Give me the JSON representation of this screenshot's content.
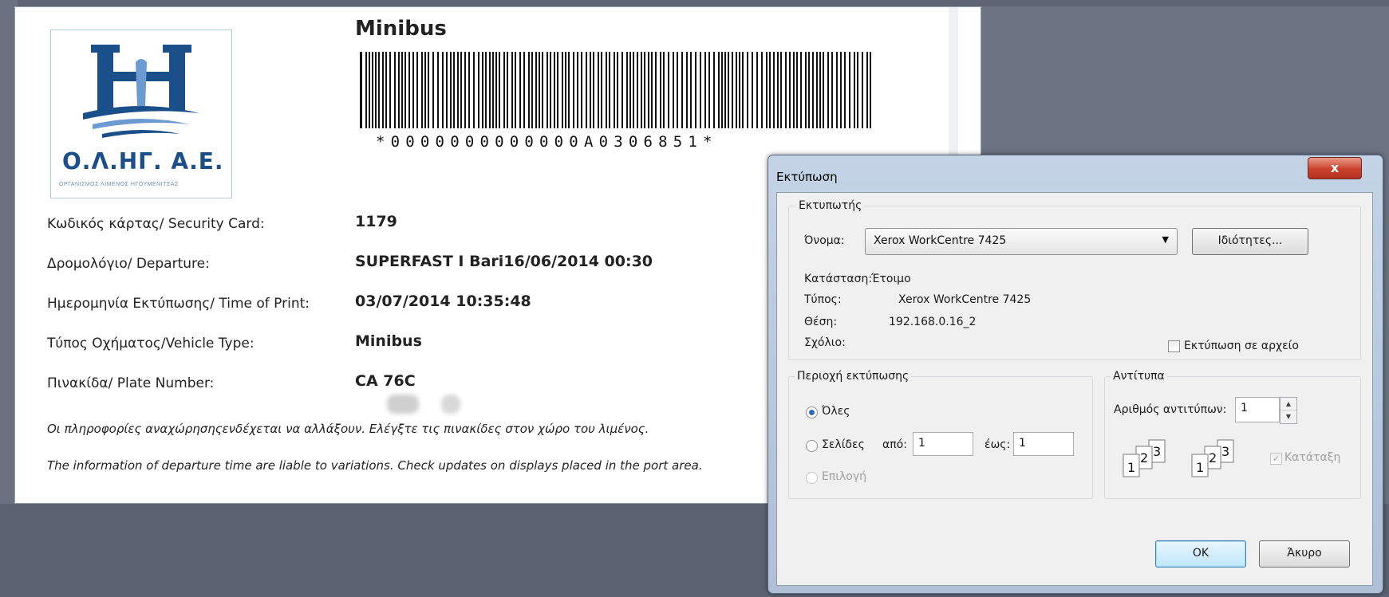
{
  "ticket": {
    "title": "Minibus",
    "logo_text": "Ο.Λ.ΗΓ.  Α.Ε.",
    "logo_subtitle": "ΟΡΓΑΝΙΣΜΟΣ ΛΙΜΕΝΟΣ ΗΓΟΥΜΕΝΙΤΣΑΣ",
    "barcode_text": "*0000000000000A0306851*",
    "rows": [
      {
        "label": "Κωδικός κάρτας/ Security Card:",
        "value": "1179"
      },
      {
        "label": "Δρομολόγιο/ Departure:",
        "value": "SUPERFAST I Bari16/06/2014 00:30"
      },
      {
        "label": "Ημερομηνία Εκτύπωσης/ Time of Print:",
        "value": "03/07/2014 10:35:48"
      },
      {
        "label": "Τύπος Οχήματος/Vehicle Type:",
        "value": "Minibus"
      },
      {
        "label": "Πινακίδα/ Plate Number:",
        "value": "CA    76C"
      }
    ],
    "note_gr": "Οι πληροφορίες αναχώρησηςενδέχεται να αλλάξουν. Ελέγξτε τις πινακίδες στον χώρο του λιμένος.",
    "note_en": "The information of departure time are liable to variations. Check updates on displays placed in the port area."
  },
  "dialog": {
    "title": "Εκτύπωση",
    "close_label": "x",
    "printer_group": "Εκτυπωτής",
    "name_label": "Όνομα:",
    "printer_name": "Xerox WorkCentre 7425",
    "properties_button": "Ιδιότητες...",
    "status_label": "Κατάσταση:",
    "status_value": "Έτοιμο",
    "type_label": "Τύπος:",
    "type_value": "Xerox WorkCentre 7425",
    "location_label": "Θέση:",
    "location_value": "192.168.0.16_2",
    "comment_label": "Σχόλιο:",
    "print_to_file_label": "Εκτύπωση σε αρχείο",
    "range_group": "Περιοχή εκτύπωσης",
    "all_label": "Όλες",
    "pages_label": "Σελίδες",
    "from_label": "από:",
    "from_value": "1",
    "to_label": "έως:",
    "to_value": "1",
    "selection_label": "Επιλογή",
    "copies_group": "Αντίτυπα",
    "copies_label": "Αριθμός αντιτύπων:",
    "copies_value": "1",
    "collate_label": "Κατάταξη",
    "ok_button": "OK",
    "cancel_button": "Άκυρο",
    "page_icon_numbers": [
      "1",
      "2",
      "3"
    ]
  }
}
